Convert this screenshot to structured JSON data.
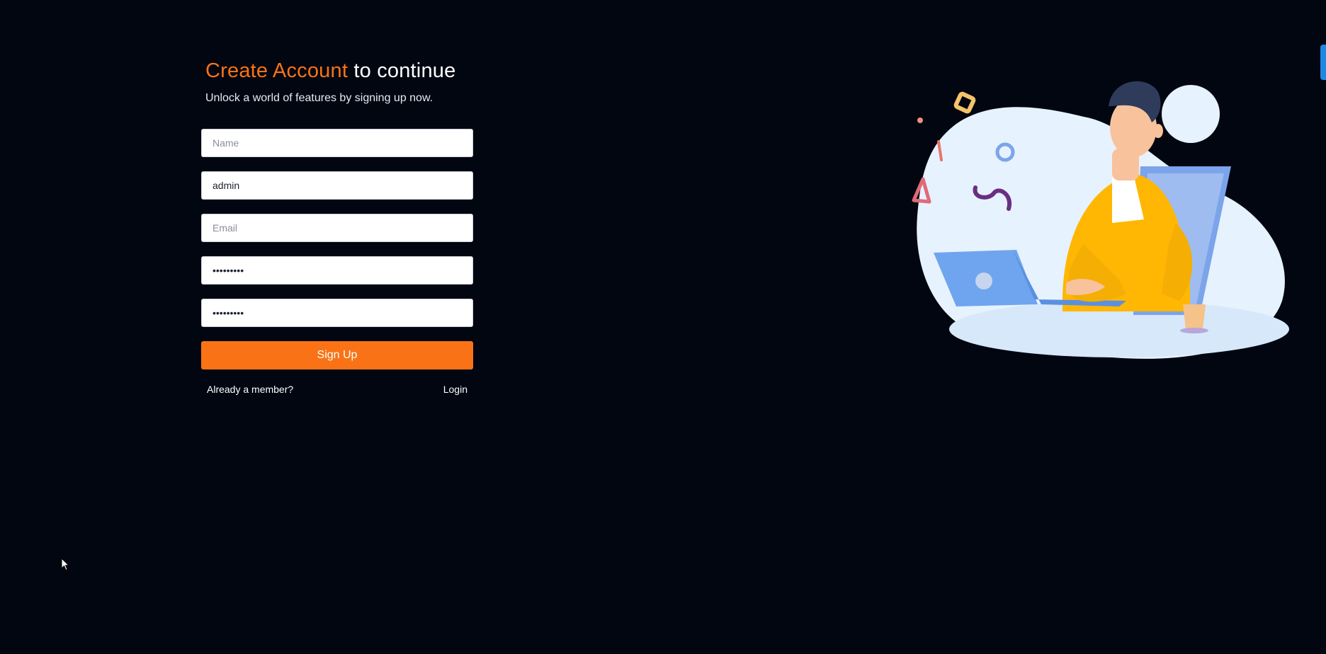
{
  "header": {
    "title_accent": "Create Account",
    "title_rest": " to continue",
    "subtitle": "Unlock a world of features by signing up now."
  },
  "form": {
    "name": {
      "placeholder": "Name",
      "value": ""
    },
    "username": {
      "placeholder": "",
      "value": "admin"
    },
    "email": {
      "placeholder": "Email",
      "value": ""
    },
    "password": {
      "value": "•••••••••"
    },
    "confirm_password": {
      "value": "•••••••••"
    },
    "submit_label": "Sign Up"
  },
  "footer": {
    "member_text": "Already a member?",
    "login_label": "Login"
  },
  "icons": {
    "illustration": "person-at-laptop-illustration",
    "cursor": "mouse-pointer-icon"
  },
  "colors": {
    "background": "#020611",
    "accent": "#f97316",
    "scrollbar": "#1e88e5"
  }
}
